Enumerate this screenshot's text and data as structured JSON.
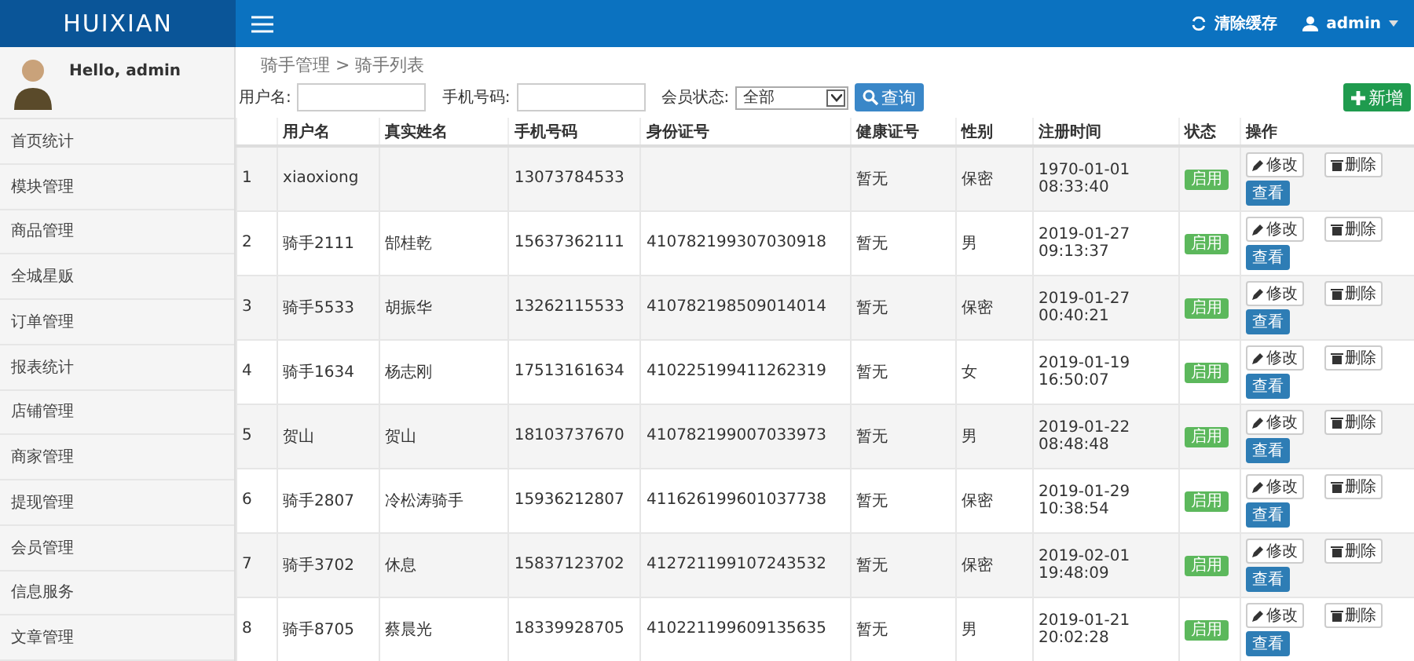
{
  "topbar": {
    "logo": "HUIXIAN",
    "clear_cache": "清除缓存",
    "user": "admin"
  },
  "sidebar": {
    "greeting": "Hello, admin",
    "items": [
      "首页统计",
      "模块管理",
      "商品管理",
      "全城星贩",
      "订单管理",
      "报表统计",
      "店铺管理",
      "商家管理",
      "提现管理",
      "会员管理",
      "信息服务",
      "文章管理"
    ]
  },
  "breadcrumb": "骑手管理 > 骑手列表",
  "filters": {
    "username_label": "用户名:",
    "phone_label": "手机号码:",
    "status_label": "会员状态:",
    "status_value": "全部",
    "search_button": "查询",
    "add_button": "新增"
  },
  "table": {
    "columns": [
      "",
      "用户名",
      "真实姓名",
      "手机号码",
      "身份证号",
      "健康证号",
      "性别",
      "注册时间",
      "状态",
      "操作"
    ],
    "rows": [
      {
        "cells": [
          "1",
          "xiaoxiong",
          "",
          "13073784533",
          "",
          "暂无",
          "保密",
          "1970-01-01 08:33:40"
        ],
        "status": "启用",
        "actions": [
          "修改",
          "删除",
          "查看"
        ]
      },
      {
        "cells": [
          "2",
          "骑手2111",
          "郜桂乾",
          "15637362111",
          "410782199307030918",
          "暂无",
          "男",
          "2019-01-27 09:13:37"
        ],
        "status": "启用",
        "actions": [
          "修改",
          "删除",
          "查看"
        ]
      },
      {
        "cells": [
          "3",
          "骑手5533",
          "胡振华",
          "13262115533",
          "410782198509014014",
          "暂无",
          "保密",
          "2019-01-27 00:40:21"
        ],
        "status": "启用",
        "actions": [
          "修改",
          "删除",
          "查看"
        ]
      },
      {
        "cells": [
          "4",
          "骑手1634",
          "杨志刚",
          "17513161634",
          "410225199411262319",
          "暂无",
          "女",
          "2019-01-19 16:50:07"
        ],
        "status": "启用",
        "actions": [
          "修改",
          "删除",
          "查看"
        ]
      },
      {
        "cells": [
          "5",
          "贺山",
          "贺山",
          "18103737670",
          "410782199007033973",
          "暂无",
          "男",
          "2019-01-22 08:48:48"
        ],
        "status": "启用",
        "actions": [
          "修改",
          "删除",
          "查看"
        ]
      },
      {
        "cells": [
          "6",
          "骑手2807",
          "冷松涛骑手",
          "15936212807",
          "411626199601037738",
          "暂无",
          "保密",
          "2019-01-29 10:38:54"
        ],
        "status": "启用",
        "actions": [
          "修改",
          "删除",
          "查看"
        ]
      },
      {
        "cells": [
          "7",
          "骑手3702",
          "休息",
          "15837123702",
          "412721199107243532",
          "暂无",
          "保密",
          "2019-02-01 19:48:09"
        ],
        "status": "启用",
        "actions": [
          "修改",
          "删除",
          "查看"
        ]
      },
      {
        "cells": [
          "8",
          "骑手8705",
          "蔡晨光",
          "18339928705",
          "410221199609135635",
          "暂无",
          "男",
          "2019-01-21 20:02:28"
        ],
        "status": "启用",
        "actions": [
          "修改",
          "删除",
          "查看"
        ]
      }
    ]
  }
}
